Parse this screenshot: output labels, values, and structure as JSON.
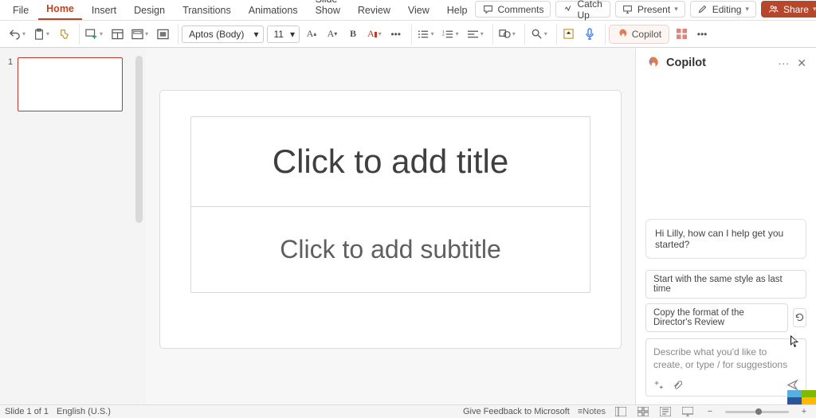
{
  "menu_tabs": [
    "File",
    "Home",
    "Insert",
    "Design",
    "Transitions",
    "Animations",
    "Slide Show",
    "Review",
    "View",
    "Help"
  ],
  "active_tab": "Home",
  "top_right": {
    "comments": "Comments",
    "catchup": "Catch Up",
    "present": "Present",
    "editing": "Editing",
    "share": "Share"
  },
  "ribbon": {
    "font_name": "Aptos (Body)",
    "font_size": "11",
    "copilot": "Copilot",
    "bold": "B"
  },
  "slides": {
    "count": 1,
    "thumb_number": "1",
    "title_placeholder": "Click to add title",
    "subtitle_placeholder": "Click to add subtitle"
  },
  "copilot": {
    "title": "Copilot",
    "greeting": "Hi Lilly, how can I help get you started?",
    "suggestion1": "Start with the same style as last time",
    "suggestion2": "Copy the format of the Director's Review",
    "input_placeholder": "Describe what you'd like to create, or type / for suggestions"
  },
  "status": {
    "slide_info": "Slide 1 of 1",
    "language": "English (U.S.)",
    "feedback": "Give Feedback to Microsoft",
    "notes": "Notes"
  }
}
